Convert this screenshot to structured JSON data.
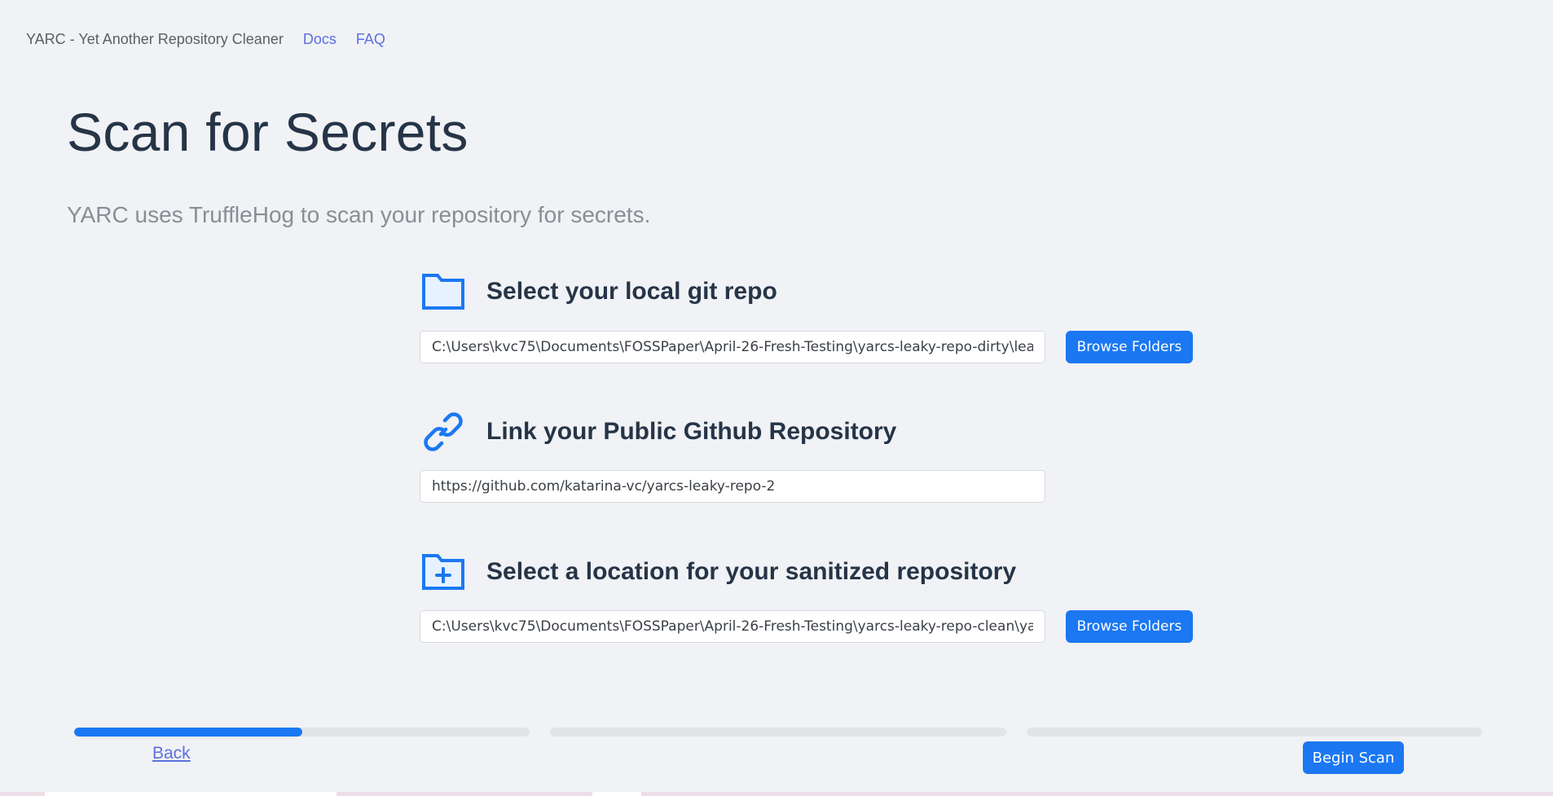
{
  "nav": {
    "brand": "YARC - Yet Another Repository Cleaner",
    "docs": "Docs",
    "faq": "FAQ"
  },
  "page": {
    "title": "Scan for Secrets",
    "subtitle": "YARC uses TruffleHog to scan your repository for secrets."
  },
  "local_repo": {
    "icon": "folder-icon",
    "heading": "Select your local git repo",
    "path_value": "C:\\Users\\kvc75\\Documents\\FOSSPaper\\April-26-Fresh-Testing\\yarcs-leaky-repo-dirty\\leaky-dirty",
    "browse_label": "Browse Folders"
  },
  "github_repo": {
    "icon": "link-icon",
    "heading": "Link your Public Github Repository",
    "url_value": "https://github.com/katarina-vc/yarcs-leaky-repo-2"
  },
  "sanitized_repo": {
    "icon": "folder-plus-icon",
    "heading": "Select a location for your sanitized repository",
    "path_value": "C:\\Users\\kvc75\\Documents\\FOSSPaper\\April-26-Fresh-Testing\\yarcs-leaky-repo-clean\\yarcs-clean",
    "browse_label": "Browse Folders"
  },
  "progress": {
    "steps": [
      {
        "fill": 0.5
      },
      {
        "fill": 0
      },
      {
        "fill": 0
      }
    ]
  },
  "footer": {
    "back_label": "Back",
    "begin_label": "Begin Scan"
  },
  "colors": {
    "accent": "#1b78f2",
    "link": "#5b6fe0",
    "background": "#f0f2f5",
    "heading": "#263447"
  }
}
